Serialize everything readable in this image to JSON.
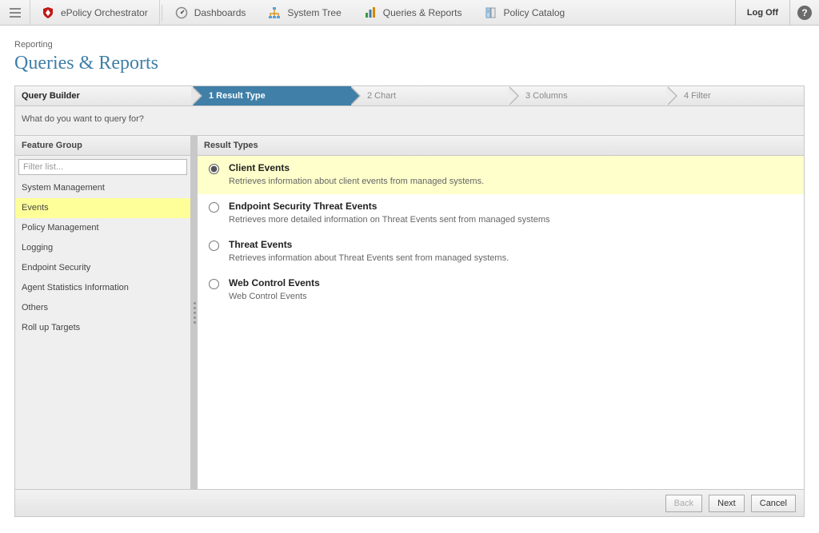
{
  "topnav": {
    "brand": "ePolicy Orchestrator",
    "items": [
      {
        "label": "Dashboards"
      },
      {
        "label": "System Tree"
      },
      {
        "label": "Queries & Reports"
      },
      {
        "label": "Policy Catalog"
      }
    ],
    "logoff": "Log Off",
    "help": "?"
  },
  "breadcrumb": "Reporting",
  "page_title": "Queries & Reports",
  "wizard": {
    "label": "Query Builder",
    "steps": [
      {
        "label": "1 Result Type",
        "active": true
      },
      {
        "label": "2 Chart"
      },
      {
        "label": "3 Columns"
      },
      {
        "label": "4 Filter"
      }
    ],
    "prompt": "What do you want to query for?"
  },
  "left": {
    "header": "Feature Group",
    "filter_placeholder": "Filter list...",
    "items": [
      "System Management",
      "Events",
      "Policy Management",
      "Logging",
      "Endpoint Security",
      "Agent Statistics Information",
      "Others",
      "Roll up Targets"
    ],
    "selected_index": 1
  },
  "right": {
    "header": "Result Types",
    "items": [
      {
        "title": "Client Events",
        "desc": "Retrieves information about client events from managed systems."
      },
      {
        "title": "Endpoint Security Threat Events",
        "desc": "Retrieves more detailed information on Threat Events sent from managed systems"
      },
      {
        "title": "Threat Events",
        "desc": "Retrieves information about Threat Events sent from managed systems."
      },
      {
        "title": "Web Control Events",
        "desc": "Web Control Events"
      }
    ],
    "selected_index": 0
  },
  "footer": {
    "back": "Back",
    "next": "Next",
    "cancel": "Cancel"
  }
}
